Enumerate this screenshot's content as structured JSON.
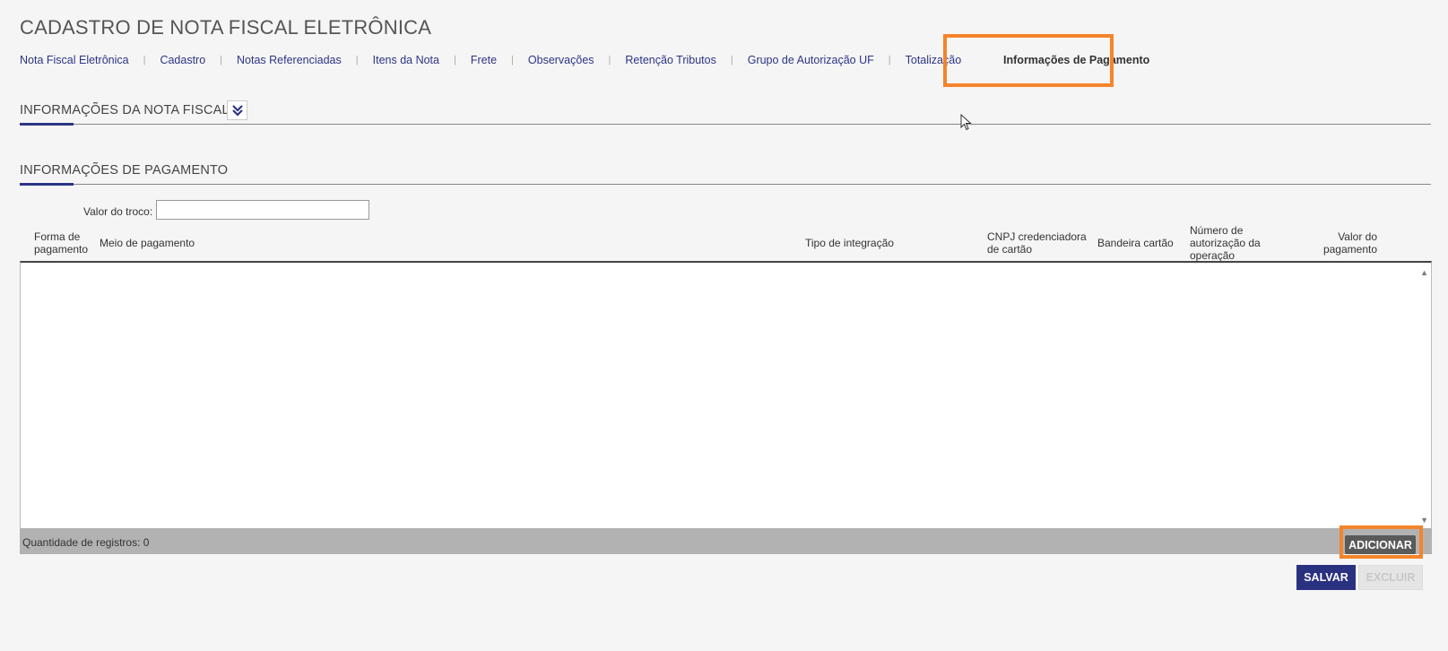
{
  "page": {
    "title": "CADASTRO DE NOTA FISCAL ELETRÔNICA"
  },
  "tabs": [
    {
      "label": "Nota Fiscal Eletrônica"
    },
    {
      "label": "Cadastro"
    },
    {
      "label": "Notas Referenciadas"
    },
    {
      "label": "Itens da Nota"
    },
    {
      "label": "Frete"
    },
    {
      "label": "Observações"
    },
    {
      "label": "Retenção Tributos"
    },
    {
      "label": "Grupo de Autorização UF"
    },
    {
      "label": "Totalização"
    },
    {
      "label": "Informações de Pagamento",
      "active": true
    }
  ],
  "sections": {
    "nota_fiscal": {
      "title": "INFORMAÇÕES DA NOTA FISCAL",
      "expand_icon": "double-chevron-down-icon"
    },
    "pagamento": {
      "title": "INFORMAÇÕES DE PAGAMENTO"
    }
  },
  "form": {
    "troco": {
      "label": "Valor do troco:",
      "value": ""
    }
  },
  "table": {
    "headers": [
      "Forma de pagamento",
      "Meio de pagamento",
      "Tipo de integração",
      "CNPJ credenciadora de cartão",
      "Bandeira cartão",
      "Número de autorização da operação",
      "Valor do pagamento"
    ],
    "rows": [],
    "footer": {
      "count_label": "Quantidade de registros: 0"
    }
  },
  "buttons": {
    "add": "ADICIONAR",
    "save": "SALVAR",
    "delete": "EXCLUIR"
  },
  "colors": {
    "accent": "#2d3585",
    "highlight": "#f5842a",
    "background": "#f5f5f5"
  }
}
